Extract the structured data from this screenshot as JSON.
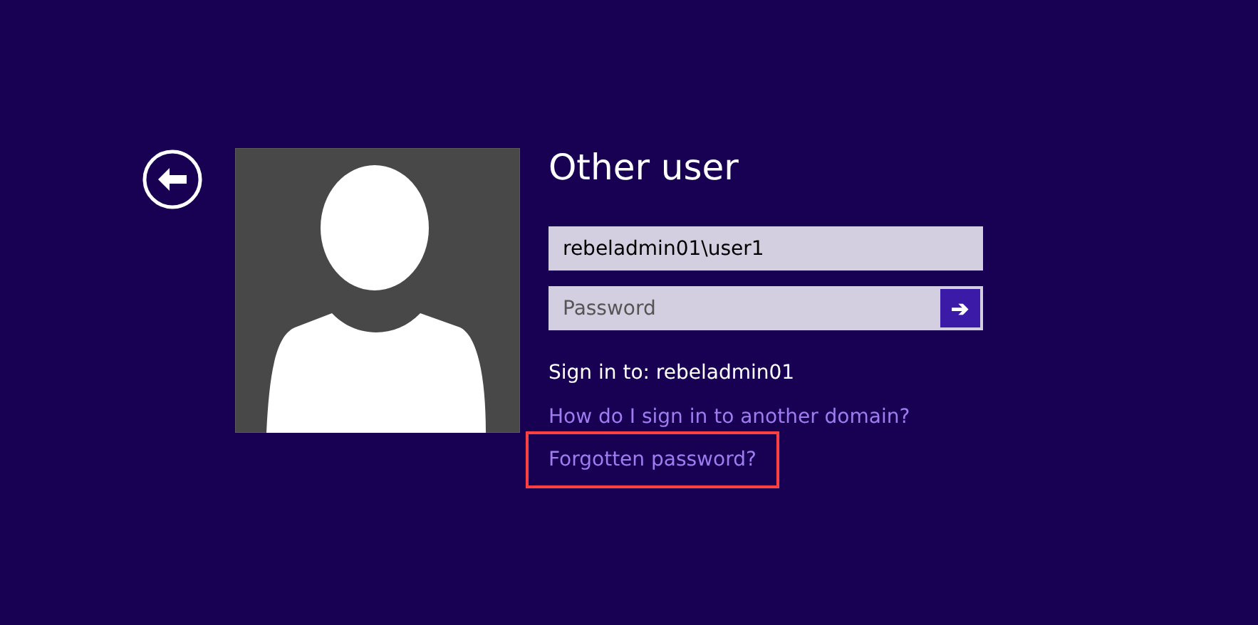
{
  "title": "Other user",
  "username": {
    "value": "rebeladmin01\\user1"
  },
  "password": {
    "placeholder": "Password"
  },
  "submit": {
    "label": "➔"
  },
  "sign_in_to": "Sign in to: rebeladmin01",
  "links": [
    {
      "label": "How do I sign in to another domain?",
      "highlighted": false
    },
    {
      "label": "Forgotten password?",
      "highlighted": true
    }
  ]
}
